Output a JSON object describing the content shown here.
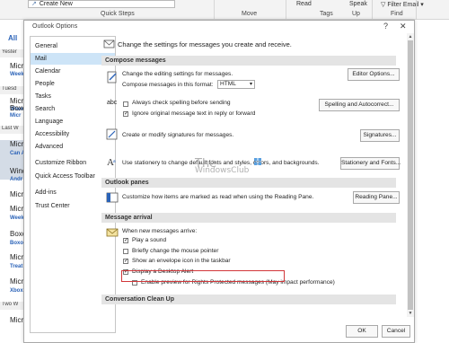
{
  "ribbon": {
    "create_new": "Create New",
    "quick_steps": "Quick Steps",
    "move": "Move",
    "read": "Read",
    "tags": "Tags",
    "speak": "Speak",
    "up": "Up",
    "filter_email": "Filter Email",
    "find": "Find"
  },
  "message_list": {
    "all": "All",
    "headers": [
      "Yester",
      "Tuesd",
      "Last W",
      "Two W"
    ],
    "items": [
      {
        "name": "Micr",
        "sub": "Week"
      },
      {
        "name": "Micr",
        "sub": "Week"
      },
      {
        "name": "Boxo",
        "sub": "Micr"
      },
      {
        "name": "Micr",
        "sub": ""
      },
      {
        "name": "Micr",
        "sub": "Can A"
      },
      {
        "name": "Wind",
        "sub": "Andr"
      },
      {
        "name": "Micr",
        "sub": ""
      },
      {
        "name": "Micr",
        "sub": "Week"
      },
      {
        "name": "Boxo",
        "sub": "Boxo"
      },
      {
        "name": "Micr",
        "sub": "Treat"
      },
      {
        "name": "Micr",
        "sub": "Xbox"
      },
      {
        "name": "Micr",
        "sub": ""
      }
    ]
  },
  "dialog": {
    "title": "Outlook Options",
    "help": "?",
    "close": "✕",
    "categories": [
      "General",
      "Mail",
      "Calendar",
      "People",
      "Tasks",
      "Search",
      "Language",
      "Accessibility",
      "Advanced",
      "Customize Ribbon",
      "Quick Access Toolbar",
      "Add-ins",
      "Trust Center"
    ],
    "selected_category": "Mail",
    "header_text": "Change the settings for messages you create and receive.",
    "compose": {
      "section": "Compose messages",
      "editing_text": "Change the editing settings for messages.",
      "editor_button": "Editor Options...",
      "format_label": "Compose messages in this format:",
      "format_value": "HTML",
      "spelling_check": "Always check spelling before sending",
      "ignore_original": "Ignore original message text in reply or forward",
      "spelling_button": "Spelling and Autocorrect...",
      "signature_text": "Create or modify signatures for messages.",
      "signatures_button": "Signatures...",
      "stationery_text": "Use stationery to change default fonts and styles, colors, and backgrounds.",
      "stationery_button": "Stationery and Fonts..."
    },
    "panes": {
      "section": "Outlook panes",
      "text": "Customize how items are marked as read when using the Reading Pane.",
      "button": "Reading Pane..."
    },
    "arrival": {
      "section": "Message arrival",
      "when_text": "When new messages arrive:",
      "options": [
        {
          "label": "Play a sound",
          "checked": true
        },
        {
          "label": "Briefly change the mouse pointer",
          "checked": false
        },
        {
          "label": "Show an envelope icon in the taskbar",
          "checked": true
        },
        {
          "label": "Display a Desktop Alert",
          "checked": true
        },
        {
          "label": "Enable preview for Rights Protected messages (May impact performance)",
          "checked": false
        }
      ]
    },
    "cleanup": {
      "section": "Conversation Clean Up"
    },
    "ok": "OK",
    "cancel": "Cancel",
    "watermark_line1": "The",
    "watermark_line2": "WindowsClub"
  },
  "colors": {
    "selected_category": "#cde4f7",
    "highlight_box": "#d2373a",
    "section_band": "#e4e4e4"
  }
}
